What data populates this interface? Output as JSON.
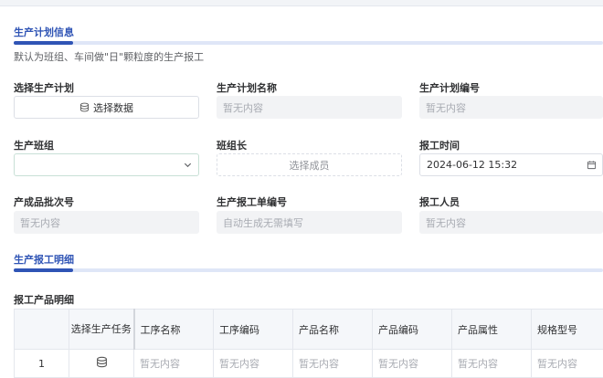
{
  "section1": {
    "title": "生产计划信息",
    "subtitle": "默认为班组、车间做\"日\"颗粒度的生产报工"
  },
  "form": {
    "select_plan": {
      "label": "选择生产计划",
      "button": "选择数据",
      "icon": "database-icon"
    },
    "plan_name": {
      "label": "生产计划名称",
      "value": "暂无内容"
    },
    "plan_code": {
      "label": "生产计划编号",
      "value": "暂无内容"
    },
    "team": {
      "label": "生产班组",
      "value": "",
      "icon": "chevron-down-icon"
    },
    "team_leader": {
      "label": "班组长",
      "button": "选择成员"
    },
    "report_time": {
      "label": "报工时间",
      "value": "2024-06-12 15:32",
      "icon": "calendar-icon"
    },
    "batch_no": {
      "label": "产成品批次号",
      "value": "暂无内容"
    },
    "report_no": {
      "label": "生产报工单编号",
      "value": "自动生成无需填写"
    },
    "reporter": {
      "label": "报工人员",
      "value": "暂无内容"
    }
  },
  "section2": {
    "title": "生产报工明细",
    "subsection": "报工产品明细"
  },
  "table": {
    "headers": [
      "",
      "选择生产任务",
      "工序名称",
      "工序编码",
      "产品名称",
      "产品编码",
      "产品属性",
      "规格型号"
    ],
    "rows": [
      {
        "index": "1",
        "icon": "database-icon",
        "cells": [
          "暂无内容",
          "暂无内容",
          "暂无内容",
          "暂无内容",
          "暂无内容",
          "暂无内容"
        ]
      }
    ]
  }
}
